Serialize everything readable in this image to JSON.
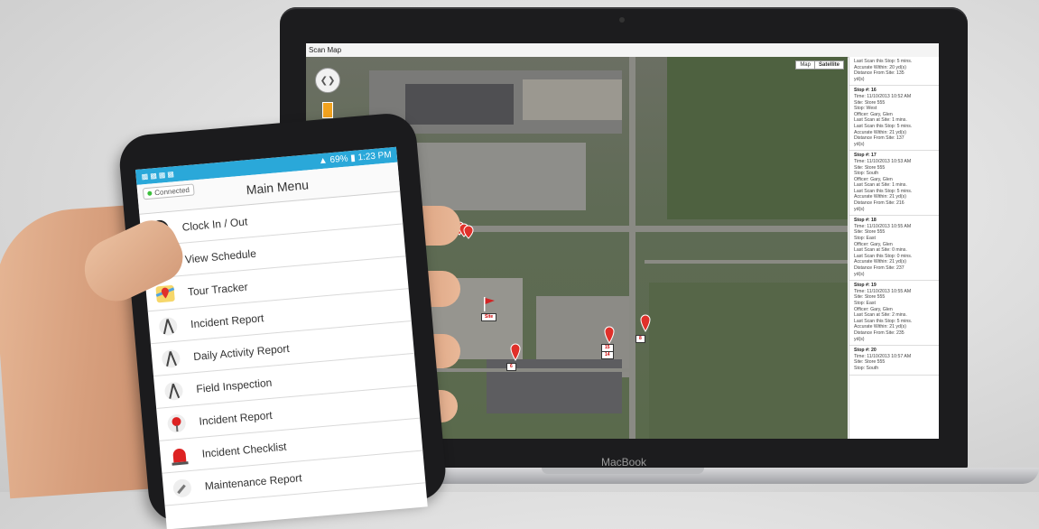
{
  "laptop": {
    "brand_label": "MacBook",
    "window_title": "Scan Map",
    "map": {
      "type_options": [
        "Map",
        "Satellite"
      ],
      "active_type": "Satellite",
      "zoom_plus": "+",
      "pins": [
        {
          "label": "",
          "cluster": true
        },
        {
          "label": "Site"
        },
        {
          "label": "8"
        },
        {
          "label": "15"
        },
        {
          "label": "14"
        },
        {
          "label": "6"
        }
      ]
    },
    "stops": [
      {
        "head": "",
        "lines": [
          "Last Scan this Stop: 5 mins.",
          "Accurate Within: 20 yd(s)",
          "Distance From Site: 135",
          "yd(s)"
        ]
      },
      {
        "head": "Stop #: 16",
        "lines": [
          "Time: 11/10/2013 10:52 AM",
          "Site: Store 555",
          "Stop: West",
          "Officer: Gary, Glen",
          "Last Scan at Site: 1 mins.",
          "Last Scan this Stop: 5 mins.",
          "Accurate Within: 21 yd(s)",
          "Distance From Site: 137",
          "yd(s)"
        ]
      },
      {
        "head": "Stop #: 17",
        "lines": [
          "Time: 11/10/2013 10:53 AM",
          "Site: Store 555",
          "Stop: South",
          "Officer: Gary, Glen",
          "Last Scan at Site: 1 mins.",
          "Last Scan this Stop: 5 mins.",
          "Accurate Within: 21 yd(s)",
          "Distance From Site: 216",
          "yd(s)"
        ]
      },
      {
        "head": "Stop #: 18",
        "lines": [
          "Time: 11/10/2013 10:55 AM",
          "Site: Store 555",
          "Stop: East",
          "Officer: Gary, Glen",
          "Last Scan at Site: 0 mins.",
          "Last Scan this Stop: 0 mins.",
          "Accurate Within: 21 yd(s)",
          "Distance From Site: 237",
          "yd(s)"
        ]
      },
      {
        "head": "Stop #: 19",
        "lines": [
          "Time: 11/10/2013 10:55 AM",
          "Site: Store 555",
          "Stop: East",
          "Officer: Gary, Glen",
          "Last Scan at Site: 2 mins.",
          "Last Scan this Stop: 5 mins.",
          "Accurate Within: 21 yd(s)",
          "Distance From Site: 235",
          "yd(s)"
        ]
      },
      {
        "head": "Stop #: 20",
        "lines": [
          "Time: 11/10/2013 10:57 AM",
          "Site: Store 555",
          "Stop: South"
        ]
      }
    ]
  },
  "phone": {
    "status_bar": {
      "battery": "69%",
      "time": "1:23 PM"
    },
    "connection_label": "Connected",
    "menu_title": "Main Menu",
    "menu_items": [
      {
        "label": "Clock In / Out",
        "icon": "clock-icon"
      },
      {
        "label": "View Schedule",
        "icon": "calendar-icon"
      },
      {
        "label": "Tour Tracker",
        "icon": "map-icon"
      },
      {
        "label": "Incident Report",
        "icon": "compass-icon"
      },
      {
        "label": "Daily Activity Report",
        "icon": "compass-icon"
      },
      {
        "label": "Field Inspection",
        "icon": "compass-icon"
      },
      {
        "label": "Incident Report",
        "icon": "stop-sign-icon"
      },
      {
        "label": "Incident Checklist",
        "icon": "siren-icon"
      },
      {
        "label": "Maintenance Report",
        "icon": "wrench-icon"
      }
    ]
  },
  "colors": {
    "accent": "#2aa8d9",
    "pin": "#e0302a",
    "connected": "#3cbf3c"
  }
}
